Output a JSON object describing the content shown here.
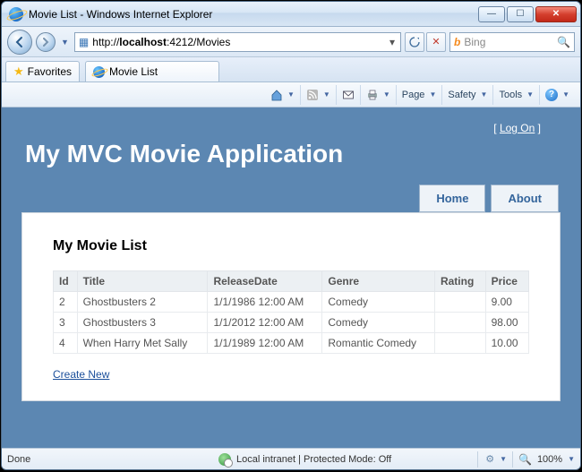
{
  "window": {
    "title": "Movie List - Windows Internet Explorer"
  },
  "url": {
    "prefix": "http://",
    "host": "localhost",
    "port_path": ":4212/Movies"
  },
  "search": {
    "provider": "Bing"
  },
  "favorites_label": "Favorites",
  "tab_label": "Movie List",
  "cmdbar": {
    "page": "Page",
    "safety": "Safety",
    "tools": "Tools"
  },
  "site": {
    "logon_label": "Log On",
    "app_title": "My MVC Movie Application",
    "nav": {
      "home": "Home",
      "about": "About"
    },
    "heading": "My Movie List",
    "columns": {
      "id": "Id",
      "title": "Title",
      "release": "ReleaseDate",
      "genre": "Genre",
      "rating": "Rating",
      "price": "Price"
    },
    "rows": [
      {
        "id": "2",
        "title": "Ghostbusters 2",
        "release": "1/1/1986 12:00 AM",
        "genre": "Comedy",
        "rating": "",
        "price": "9.00"
      },
      {
        "id": "3",
        "title": "Ghostbusters 3",
        "release": "1/1/2012 12:00 AM",
        "genre": "Comedy",
        "rating": "",
        "price": "98.00"
      },
      {
        "id": "4",
        "title": "When Harry Met Sally",
        "release": "1/1/1989 12:00 AM",
        "genre": "Romantic Comedy",
        "rating": "",
        "price": "10.00"
      }
    ],
    "create_label": "Create New"
  },
  "status": {
    "left": "Done",
    "zone": "Local intranet | Protected Mode: Off",
    "zoom": "100%"
  }
}
